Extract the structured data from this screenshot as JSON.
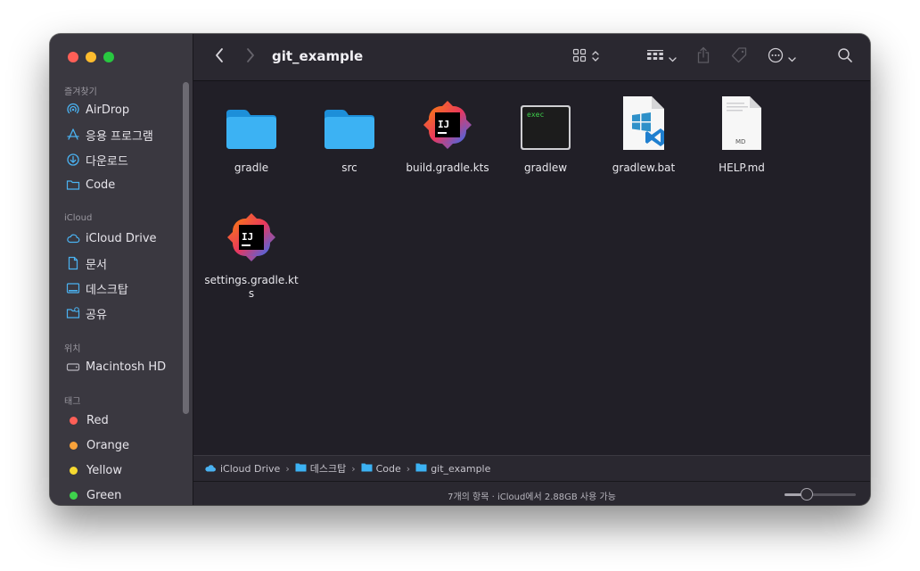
{
  "window": {
    "title": "git_example"
  },
  "sidebar": {
    "favorites_header": "즐겨찾기",
    "favorites": [
      {
        "label": "AirDrop",
        "icon": "airdrop-icon"
      },
      {
        "label": "응용 프로그램",
        "icon": "applications-icon"
      },
      {
        "label": "다운로드",
        "icon": "downloads-icon"
      },
      {
        "label": "Code",
        "icon": "folder-icon"
      }
    ],
    "icloud_header": "iCloud",
    "icloud": [
      {
        "label": "iCloud Drive",
        "icon": "cloud-icon"
      },
      {
        "label": "문서",
        "icon": "document-icon"
      },
      {
        "label": "데스크탑",
        "icon": "desktop-icon"
      },
      {
        "label": "공유",
        "icon": "shared-folder-icon"
      }
    ],
    "locations_header": "위치",
    "locations": [
      {
        "label": "Macintosh HD",
        "icon": "disk-icon"
      }
    ],
    "tags_header": "태그",
    "tags": [
      {
        "label": "Red",
        "color": "#fe5f57"
      },
      {
        "label": "Orange",
        "color": "#f9a23a"
      },
      {
        "label": "Yellow",
        "color": "#f6d930"
      },
      {
        "label": "Green",
        "color": "#3ed14c"
      }
    ]
  },
  "files": [
    {
      "name": "gradle",
      "icon": "folder-icon"
    },
    {
      "name": "src",
      "icon": "folder-icon"
    },
    {
      "name": "build.gradle.kts",
      "icon": "intellij-icon",
      "badge": "IJ"
    },
    {
      "name": "gradlew",
      "icon": "exec-icon",
      "badge": "exec"
    },
    {
      "name": "gradlew.bat",
      "icon": "bat-file-icon"
    },
    {
      "name": "HELP.md",
      "icon": "markdown-file-icon",
      "badge": "MD"
    },
    {
      "name": "settings.gradle.kts",
      "icon": "intellij-icon",
      "badge": "IJ"
    }
  ],
  "pathbar": {
    "crumbs": [
      "iCloud Drive",
      "데스크탑",
      "Code",
      "git_example"
    ]
  },
  "status": {
    "text": "7개의 항목 · iCloud에서 2.88GB 사용 가능",
    "icon_size_slider": 0.28
  },
  "colors": {
    "accent": "#2aa6f0",
    "sidebar_bg": "#3a3840",
    "content_bg": "#211f27"
  }
}
